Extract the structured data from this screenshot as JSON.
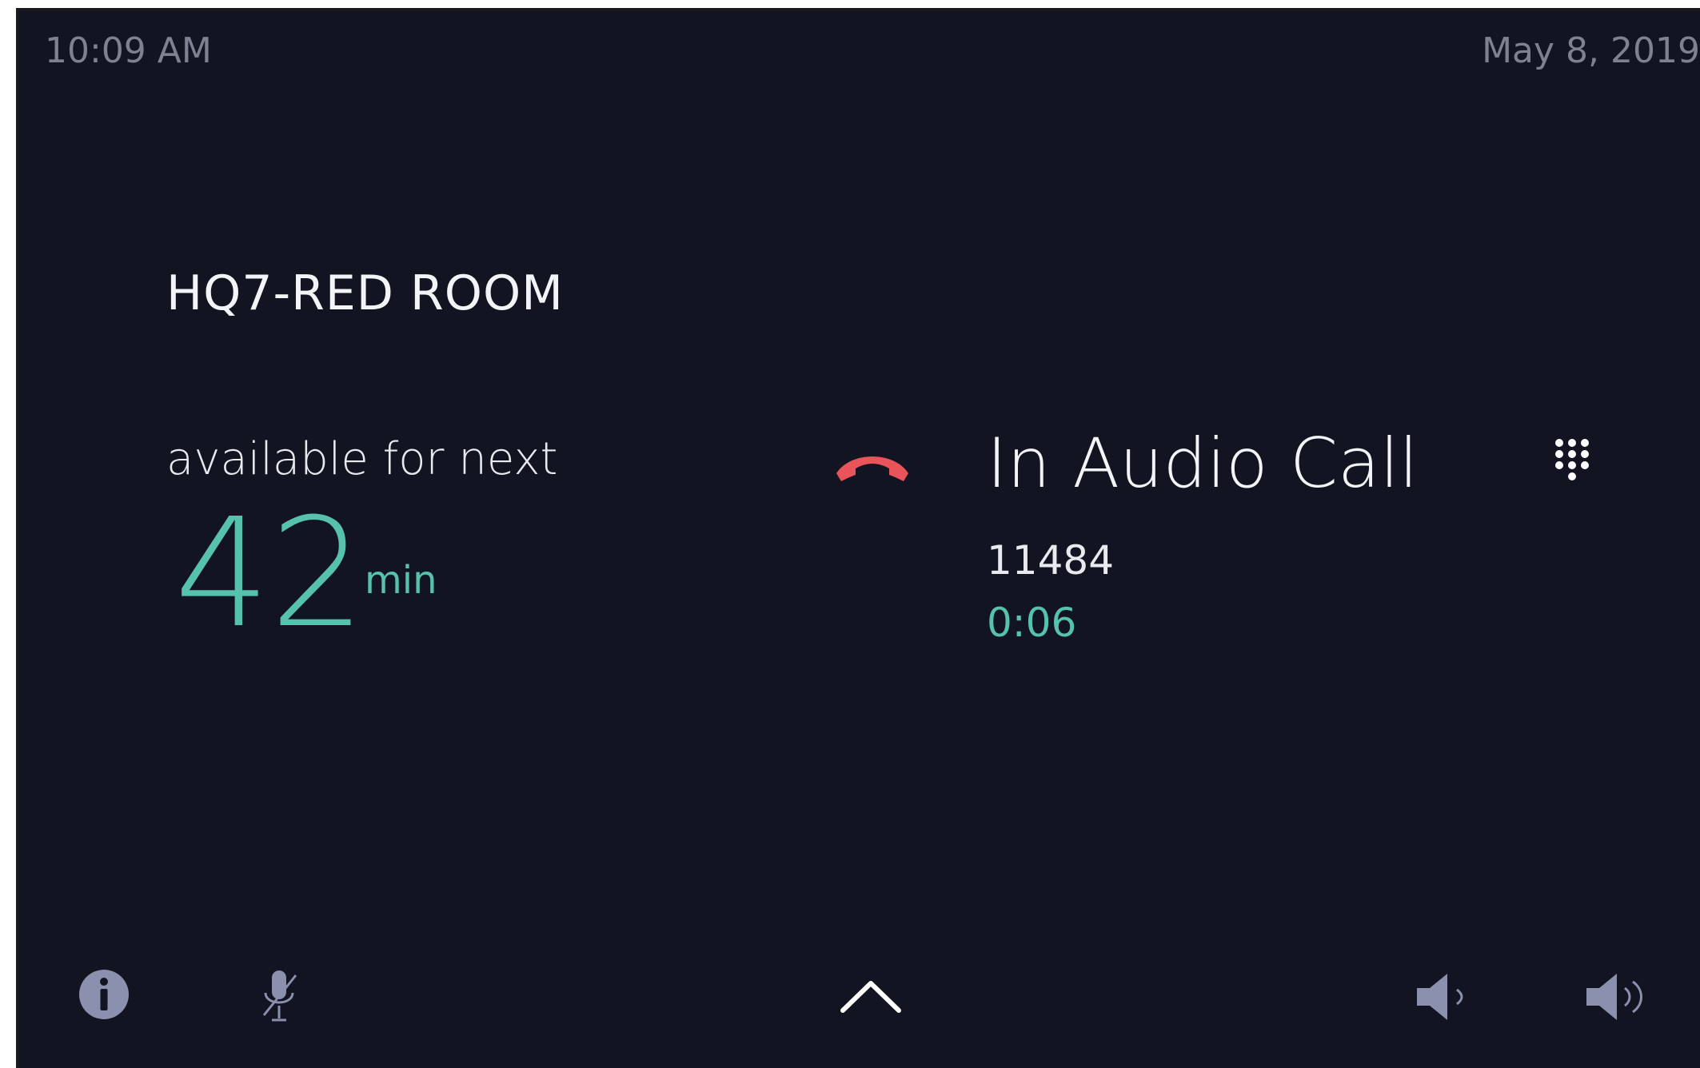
{
  "status_bar": {
    "time": "10:09 AM",
    "date": "May 8, 2019"
  },
  "room": {
    "name": "HQ7-RED ROOM"
  },
  "availability": {
    "label": "available for next",
    "value": "42",
    "unit": "min"
  },
  "call": {
    "status": "In Audio Call",
    "number": "11484",
    "duration": "0:06"
  },
  "icons": {
    "hangup": "hang-up-phone-icon",
    "keypad": "dialpad-icon",
    "info": "info-icon",
    "mic": "microphone-muted-icon",
    "up": "chevron-up-icon",
    "volume_down": "volume-down-icon",
    "volume_up": "volume-up-icon"
  },
  "colors": {
    "background": "#121521",
    "accent": "#57c2ab",
    "hangup": "#e8545a",
    "muted_text": "#7d8191",
    "icon_muted": "#8a90ad"
  }
}
